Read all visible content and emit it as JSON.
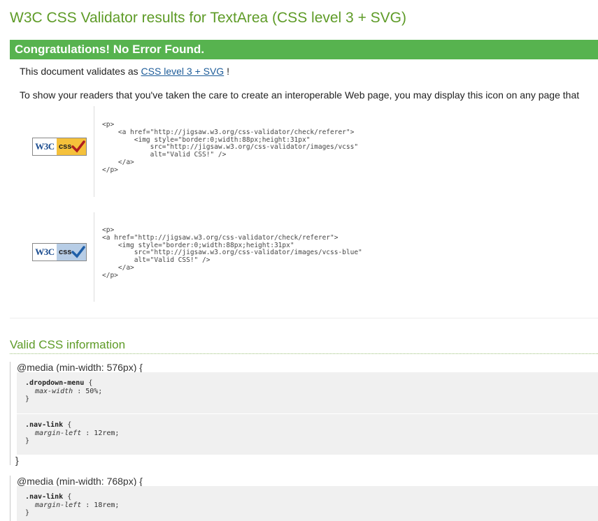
{
  "page": {
    "title": "W3C CSS Validator results for TextArea (CSS level 3 + SVG)",
    "banner": "Congratulations! No Error Found.",
    "validates_prefix": "This document validates as ",
    "validates_link": "CSS level 3 + SVG",
    "validates_suffix": " !",
    "readers_text": "To show your readers that you've taken the care to create an interoperable Web page, you may display this icon on any page that"
  },
  "badges": [
    {
      "w3c": "W3C",
      "css": "css",
      "checkmark_color": "#b01e1e",
      "code": "<p>\n    <a href=\"http://jigsaw.w3.org/css-validator/check/referer\">\n        <img style=\"border:0;width:88px;height:31px\"\n            src=\"http://jigsaw.w3.org/css-validator/images/vcss\"\n            alt=\"Valid CSS!\" />\n    </a>\n</p>"
    },
    {
      "w3c": "W3C",
      "css": "css",
      "checkmark_color": "#1f5fa8",
      "code": "<p>\n<a href=\"http://jigsaw.w3.org/css-validator/check/referer\">\n    <img style=\"border:0;width:88px;height:31px\"\n        src=\"http://jigsaw.w3.org/css-validator/images/vcss-blue\"\n        alt=\"Valid CSS!\" />\n    </a>\n</p>"
    }
  ],
  "info": {
    "title": "Valid CSS information",
    "medias": [
      {
        "query": "@media (min-width: 576px) {",
        "close": "}",
        "rules": [
          {
            "selector": ".dropdown-menu",
            "open": " {",
            "property": "max-width",
            "sep": " : ",
            "value": "50%;",
            "close": "}"
          },
          {
            "selector": ".nav-link",
            "open": " {",
            "property": "margin-left",
            "sep": " : ",
            "value": "12rem;",
            "close": "}"
          }
        ]
      },
      {
        "query": "@media (min-width: 768px) {",
        "close": "}",
        "rules": [
          {
            "selector": ".nav-link",
            "open": " {",
            "property": "margin-left",
            "sep": " : ",
            "value": "18rem;",
            "close": "}"
          }
        ]
      }
    ]
  },
  "colors": {
    "title_green": "#5e9b27",
    "banner_green": "#57b34f",
    "link_blue": "#1d5c99"
  }
}
